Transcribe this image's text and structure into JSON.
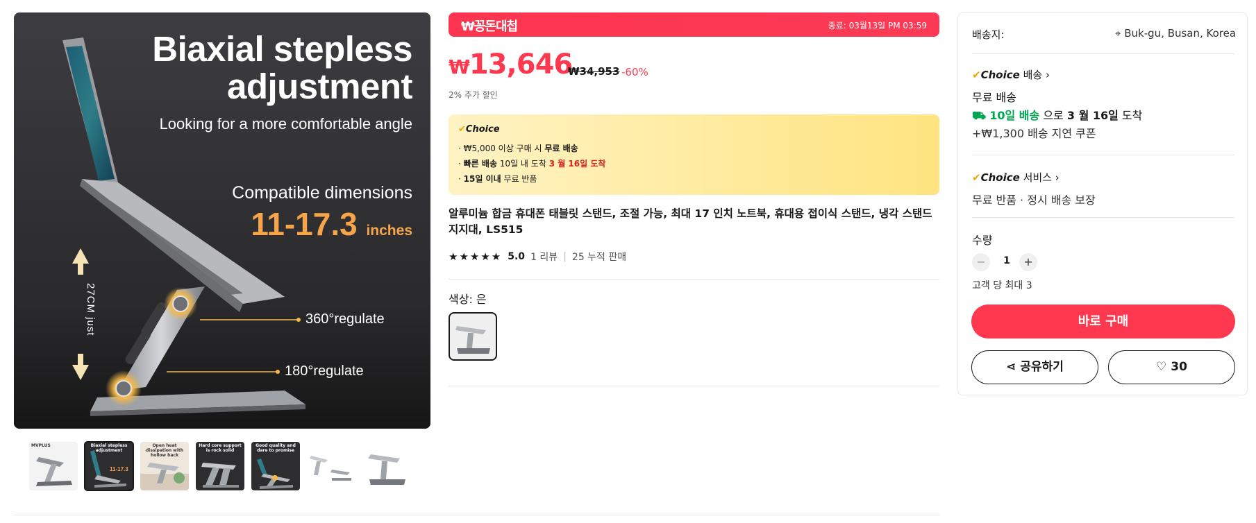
{
  "hero": {
    "headline_1": "Biaxial stepless",
    "headline_2": "adjustment",
    "subhead": "Looking for a more comfortable angle",
    "compat_label": "Compatible dimensions",
    "size_value": "11-17.3",
    "size_unit": "inches",
    "regulate_1": "360°regulate",
    "regulate_2": "180°regulate",
    "height_label": "27CM just"
  },
  "thumbnails": [
    {
      "caption": "MVPLUS"
    },
    {
      "caption": "Biaxial stepless adjustment"
    },
    {
      "caption": "Open heat dissipation with hollow back"
    },
    {
      "caption": "Hard core support is rock solid"
    },
    {
      "caption": "Good quality and dare to promise"
    },
    {
      "caption": ""
    },
    {
      "caption": ""
    }
  ],
  "banner": {
    "logo": "₩꽁돈대첩",
    "timer": "종료: 03월13일 PM 03:59"
  },
  "price": {
    "currency": "₩",
    "current": "13,646",
    "original": "₩34,953",
    "discount": "-60%",
    "extra_discount": "2% 추가 할인"
  },
  "choice_box": {
    "label": "Choice",
    "line1_a": "· ₩5,000 이상 구매 시 ",
    "line1_b": "무료 배송",
    "line2_a": "· ",
    "line2_b": "빠른 배송",
    "line2_c": " 10일 내 도착 ",
    "line2_d": "3 월 16일 도착",
    "line3_a": "· ",
    "line3_b": "15일 이내",
    "line3_c": " 무료 반품"
  },
  "product": {
    "title": "알루미늄 합금 휴대폰 태블릿 스탠드, 조절 가능, 최대 17 인치 노트북, 휴대용 접이식 스탠드, 냉각 스탠드 지지대, LS515",
    "rating": "5.0",
    "reviews": "1 리뷰",
    "sold": "25 누적 판매",
    "color_label": "색상: 은"
  },
  "side": {
    "ship_to_label": "배송지:",
    "location": "Buk-gu, Busan, Korea",
    "choice_shipping": "배송",
    "choice_word": "Choice",
    "free_ship": "무료 배송",
    "eta_fast": "10일 배송",
    "eta_mid": " 으로 ",
    "eta_date": "3 월 16일",
    "eta_end": " 도착",
    "coupon": "+₩1,300 배송 지연 쿠폰",
    "choice_service": "서비스",
    "service_desc": "무료 반품 · 정시 배송 보장",
    "qty_label": "수량",
    "qty_value": "1",
    "qty_limit": "고객 당 최대 3",
    "buy_now": "바로 구매",
    "share": "공유하기",
    "wishlist_count": "30"
  },
  "colors": {
    "accent": "#fd384f",
    "choice_gold": "#f1a308",
    "green": "#00a650"
  }
}
